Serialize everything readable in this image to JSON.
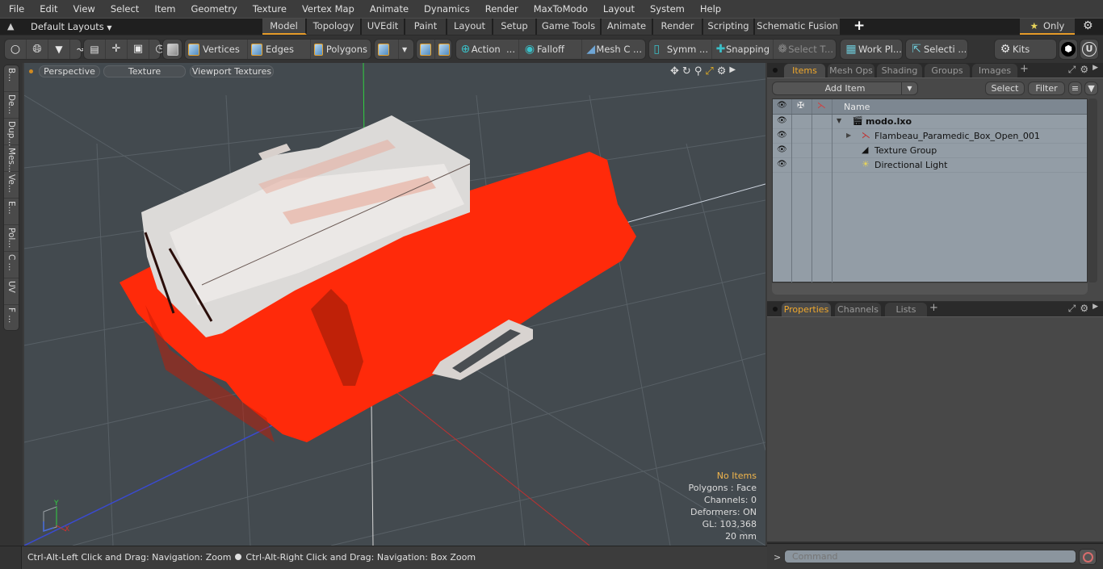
{
  "menubar": [
    "File",
    "Edit",
    "View",
    "Select",
    "Item",
    "Geometry",
    "Texture",
    "Vertex Map",
    "Animate",
    "Dynamics",
    "Render",
    "MaxToModo",
    "Layout",
    "System",
    "Help"
  ],
  "layout_bar": {
    "layouts_label": "Default Layouts",
    "tabs": [
      "Model",
      "Topology",
      "UVEdit",
      "Paint",
      "Layout",
      "Setup",
      "Game Tools",
      "Animate",
      "Render",
      "Scripting",
      "Schematic Fusion"
    ],
    "active_tab": "Model",
    "add_tab": "+",
    "only_label": "Only"
  },
  "toolbar": {
    "vertices": "Vertices",
    "edges": "Edges",
    "polygons": "Polygons",
    "action": "Action",
    "falloff": "Falloff",
    "mesh_c": "Mesh C ...",
    "symm": "Symm ...",
    "snapping": "Snapping",
    "select_t": "Select T...",
    "work_pl": "Work Pl...",
    "selecti": "Selecti ...",
    "kits": "Kits",
    "ellipsis": "..."
  },
  "left_tabs": [
    "B...",
    "De...",
    "Dup...",
    "Mes...",
    "Ve...",
    "E...",
    "Pol...",
    "C ...",
    "UV",
    "F ..."
  ],
  "viewport": {
    "view_mode": "Perspective",
    "shading": "Texture",
    "texture_mode": "Viewport Textures",
    "stats": {
      "selection": "No Items",
      "polygons": "Polygons : Face",
      "channels": "Channels: 0",
      "deformers": "Deformers: ON",
      "gl": "GL: 103,368",
      "unit": "20 mm"
    },
    "axis_labels": {
      "x": "X",
      "y": "Y"
    }
  },
  "items_panel": {
    "tabs": [
      "Items",
      "Mesh Ops",
      "Shading",
      "Groups",
      "Images"
    ],
    "active_tab": "Items",
    "add_item": "Add Item",
    "select": "Select",
    "filter": "Filter",
    "column_name": "Name",
    "tree": [
      {
        "label": "modo.lxo",
        "depth": 0,
        "bold": true,
        "icon": "scene-icon"
      },
      {
        "label": "Flambeau_Paramedic_Box_Open_001",
        "depth": 1,
        "icon": "mesh-locator-icon"
      },
      {
        "label": "Texture Group",
        "depth": 1,
        "icon": "texture-group-icon"
      },
      {
        "label": "Directional Light",
        "depth": 1,
        "icon": "light-icon"
      }
    ]
  },
  "properties_panel": {
    "tabs": [
      "Properties",
      "Channels",
      "Lists"
    ],
    "active_tab": "Properties"
  },
  "command": {
    "prompt": ">",
    "placeholder": "Command"
  },
  "status": {
    "left": "Ctrl-Alt-Left Click and Drag: Navigation: Zoom",
    "right": "Ctrl-Alt-Right Click and Drag: Navigation: Box Zoom"
  },
  "colors": {
    "accent": "#e69b28",
    "model_red": "#ff2a0a",
    "model_white": "#dcdcdc"
  }
}
